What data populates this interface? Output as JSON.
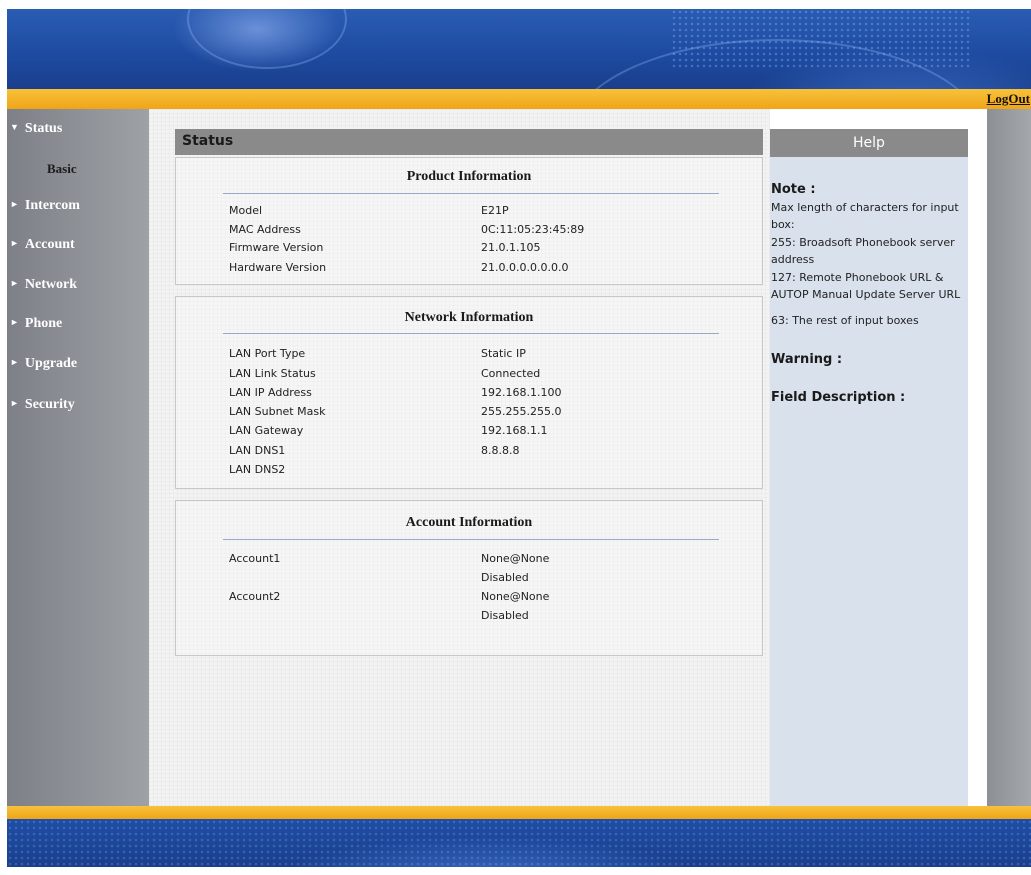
{
  "header": {
    "logout_label": "LogOut"
  },
  "sidebar": {
    "items": [
      {
        "label": "Status",
        "arrow": "▼"
      },
      {
        "label": "Intercom",
        "arrow": "►"
      },
      {
        "label": "Account",
        "arrow": "►"
      },
      {
        "label": "Network",
        "arrow": "►"
      },
      {
        "label": "Phone",
        "arrow": "►"
      },
      {
        "label": "Upgrade",
        "arrow": "►"
      },
      {
        "label": "Security",
        "arrow": "►"
      }
    ],
    "sub_items": [
      {
        "label": "Basic"
      }
    ]
  },
  "main": {
    "title": "Status",
    "product": {
      "title": "Product Information",
      "rows": [
        {
          "label": "Model",
          "value": "E21P"
        },
        {
          "label": "MAC Address",
          "value": "0C:11:05:23:45:89"
        },
        {
          "label": "Firmware Version",
          "value": "21.0.1.105"
        },
        {
          "label": "Hardware Version",
          "value": "21.0.0.0.0.0.0.0"
        }
      ]
    },
    "network": {
      "title": "Network Information",
      "rows": [
        {
          "label": "LAN Port Type",
          "value": "Static IP"
        },
        {
          "label": "LAN Link Status",
          "value": "Connected"
        },
        {
          "label": "LAN IP Address",
          "value": "192.168.1.100"
        },
        {
          "label": "LAN Subnet Mask",
          "value": "255.255.255.0"
        },
        {
          "label": "LAN Gateway",
          "value": "192.168.1.1"
        },
        {
          "label": "LAN DNS1",
          "value": "8.8.8.8"
        },
        {
          "label": "LAN DNS2",
          "value": ""
        }
      ]
    },
    "account": {
      "title": "Account Information",
      "rows": [
        {
          "label": "Account1",
          "value": "None@None",
          "status": "Disabled"
        },
        {
          "label": "Account2",
          "value": "None@None",
          "status": "Disabled"
        }
      ]
    }
  },
  "help": {
    "title": "Help",
    "note_heading": "Note :",
    "note_lines": [
      "Max length of characters for input box:",
      "255: Broadsoft Phonebook server address",
      "127: Remote Phonebook URL & AUTOP Manual Update Server URL",
      "63: The rest of input boxes"
    ],
    "warning_heading": "Warning :",
    "field_heading": "Field Description :"
  },
  "colors": {
    "accent_orange": "#f0a418",
    "banner_blue": "#1d4aa0",
    "sidebar_gray": "#8e9297",
    "help_bg": "#d8e1ec"
  }
}
